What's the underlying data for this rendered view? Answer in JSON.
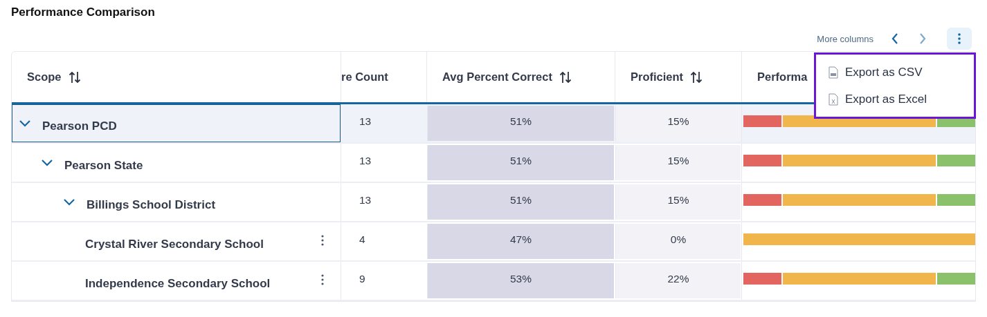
{
  "title": "Performance Comparison",
  "toolbar": {
    "more_columns": "More columns",
    "prev": {
      "disabled": false
    },
    "next": {
      "disabled": true
    },
    "menu_button": {
      "active": true
    }
  },
  "menu": {
    "items": [
      {
        "kind": "csv",
        "label": "Export as CSV"
      },
      {
        "kind": "excel",
        "label": "Export as Excel"
      }
    ]
  },
  "table": {
    "columns": [
      {
        "label": "Scope",
        "kind": "sortable"
      },
      {
        "label": "re Count",
        "kind": "plain"
      },
      {
        "label": "Avg Percent Correct",
        "kind": "sortable"
      },
      {
        "label": "Proficient",
        "kind": "sortable"
      },
      {
        "label": "Performa",
        "kind": "plain"
      }
    ],
    "rows": [
      {
        "kind": "group",
        "name": "Pearson PCD",
        "expanded": true,
        "selected": true,
        "count": "13",
        "avg": "51%",
        "proficient": "15%",
        "bars": [
          {
            "color": "#e2665f"
          },
          {
            "color": "#f0b54b"
          },
          {
            "color": "#8bc16b"
          }
        ],
        "children": [
          {
            "kind": "group",
            "name": "Pearson State",
            "expanded": true,
            "selected": false,
            "count": "13",
            "avg": "51%",
            "proficient": "15%",
            "bars": [
              {
                "color": "#e2665f"
              },
              {
                "color": "#f0b54b"
              },
              {
                "color": "#8bc16b"
              }
            ],
            "children": [
              {
                "kind": "group",
                "name": "Billings School District",
                "expanded": true,
                "selected": false,
                "count": "13",
                "avg": "51%",
                "proficient": "15%",
                "bars": [
                  {
                    "color": "#e2665f"
                  },
                  {
                    "color": "#f0b54b"
                  },
                  {
                    "color": "#8bc16b"
                  }
                ],
                "children": [
                  {
                    "kind": "school",
                    "name": "Crystal River Secondary School",
                    "selected": false,
                    "count": "4",
                    "avg": "47%",
                    "proficient": "0%",
                    "bars": [
                      {
                        "color": "#f0b54b"
                      }
                    ]
                  },
                  {
                    "kind": "school",
                    "name": "Independence Secondary School",
                    "selected": false,
                    "count": "9",
                    "avg": "53%",
                    "proficient": "22%",
                    "bars": [
                      {
                        "color": "#e2665f"
                      },
                      {
                        "color": "#f0b54b"
                      },
                      {
                        "color": "#8bc16b"
                      }
                    ]
                  }
                ]
              }
            ]
          }
        ]
      }
    ]
  }
}
